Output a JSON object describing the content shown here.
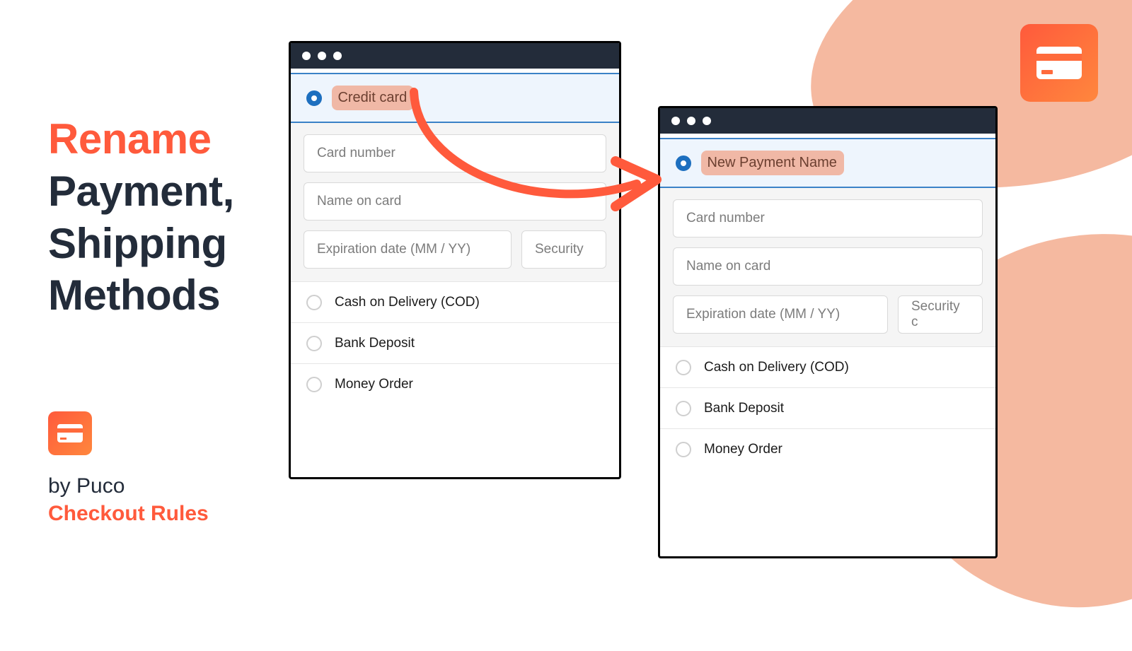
{
  "headline": {
    "line1": "Rename",
    "line2": "Payment,",
    "line3": "Shipping",
    "line4": "Methods"
  },
  "byline": {
    "prefix": "by Puco",
    "product": "Checkout Rules"
  },
  "window_a": {
    "selected_label": "Credit card",
    "fields": {
      "card_number": "Card number",
      "name_on_card": "Name on card",
      "expiration": "Expiration date (MM / YY)",
      "security": "Security"
    },
    "options": [
      "Cash on Delivery (COD)",
      "Bank Deposit",
      "Money Order"
    ]
  },
  "window_b": {
    "selected_label": "New Payment Name",
    "fields": {
      "card_number": "Card number",
      "name_on_card": "Name on card",
      "expiration": "Expiration date (MM / YY)",
      "security": "Security c"
    },
    "options": [
      "Cash on Delivery (COD)",
      "Bank Deposit",
      "Money Order"
    ]
  }
}
